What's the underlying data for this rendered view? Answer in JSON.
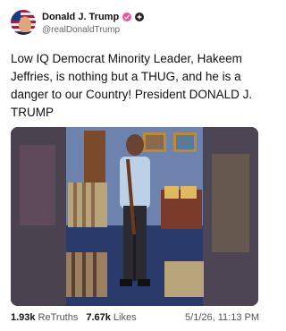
{
  "author": {
    "display_name": "Donald J. Trump",
    "handle": "@realDonaldTrump",
    "avatar_icon": "flag-avatar",
    "verified_icon": "verified-check-icon",
    "plus_icon": "plus-badge-icon"
  },
  "post": {
    "text": "Low IQ Democrat Minority Leader, Hakeem Jeffries, is nothing but a THUG, and he is a danger to our Country! President DONALD J. TRUMP",
    "media_description_icon": "video-thumbnail"
  },
  "stats": {
    "retruths_count": "1.93k",
    "retruths_label": "ReTruths",
    "likes_count": "7.67k",
    "likes_label": "Likes",
    "timestamp": "5/1/26, 11:13 PM"
  },
  "colors": {
    "verified_badge": "#e8579a",
    "plus_badge": "#222222",
    "text_primary": "#111111",
    "text_secondary": "#666666"
  }
}
